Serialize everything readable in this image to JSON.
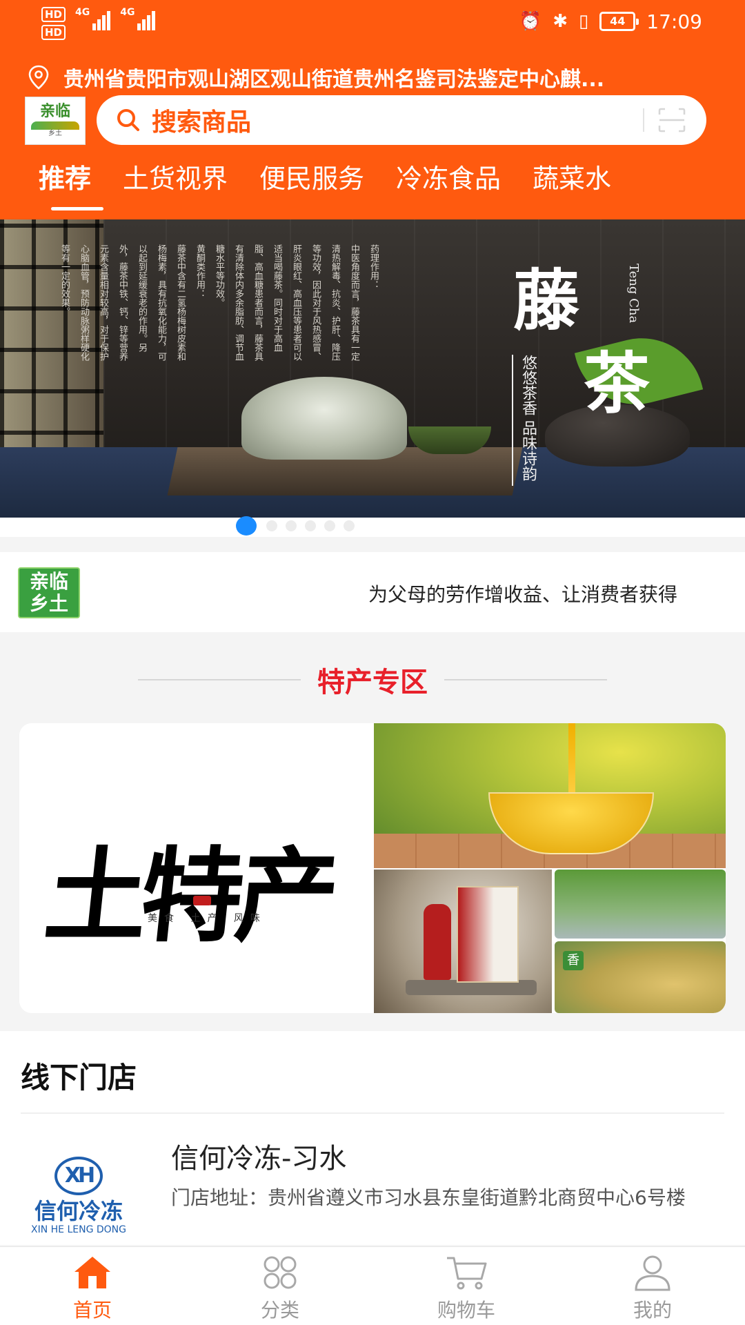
{
  "status_bar": {
    "hd1": "HD",
    "hd2": "HD",
    "net1": "4G",
    "net2": "4G",
    "battery": "44",
    "time": "17:09"
  },
  "location": {
    "text": "贵州省贵阳市观山湖区观山街道贵州名鉴司法鉴定中心麒..."
  },
  "search": {
    "placeholder": "搜索商品"
  },
  "tabs": [
    {
      "label": "推荐",
      "active": true
    },
    {
      "label": "土货视界"
    },
    {
      "label": "便民服务"
    },
    {
      "label": "冷冻食品"
    },
    {
      "label": "蔬菜水"
    }
  ],
  "banner": {
    "title_1": "藤",
    "title_2": "茶",
    "en": "Teng Cha",
    "slogan": "悠悠茶香 品味诗韵",
    "poem_cols": [
      "药理作用：",
      "中医角度而言，藤茶具有一定",
      "清热解毒、抗炎、护肝、降压",
      "等功效，因此对于风热感冒、",
      "肝炎眼红、高血压等患者可以",
      "适当喝藤茶。同时对于高血",
      "脂、高血糖患者而言，藤茶具",
      "有清除体内多余脂肪、调节血",
      "糖水平等功效。",
      "黄酮类作用：",
      "藤茶中含有二氢杨梅树皮素和",
      "杨梅素，具有抗氧化能力，可",
      "以起到延缓衰老的作用。另",
      "外，藤茶中铁、钙、锌等营养",
      "元素含量相对较高，对于保护",
      "心脑血管，预防动脉粥样硬化",
      "等有一定的效果。"
    ],
    "slide_count": 6,
    "active_slide": 0
  },
  "notice": {
    "logo_line1": "亲临",
    "logo_line2": "乡土",
    "text": "为父母的劳作增收益、让消费者获得"
  },
  "specialty": {
    "title": "特产专区",
    "calligraphy": "土特产",
    "calligraphy_sub": "美食 土产 风味",
    "rice_tag": "香"
  },
  "stores": {
    "title": "线下门店",
    "items": [
      {
        "logo_mark": "XH",
        "logo_zh": "信何冷冻",
        "logo_en": "XIN HE LENG DONG",
        "name": "信何冷冻-习水",
        "address": "门店地址：贵州省遵义市习水县东皇街道黔北商贸中心6号楼"
      }
    ]
  },
  "bottom_nav": [
    {
      "label": "首页",
      "icon": "home-icon",
      "active": true
    },
    {
      "label": "分类",
      "icon": "category-icon"
    },
    {
      "label": "购物车",
      "icon": "cart-icon"
    },
    {
      "label": "我的",
      "icon": "profile-icon"
    }
  ],
  "colors": {
    "brand": "#ff5a0f",
    "section_title": "#e8202a",
    "store_blue": "#1f5fae",
    "dot_active": "#1a8cff"
  }
}
